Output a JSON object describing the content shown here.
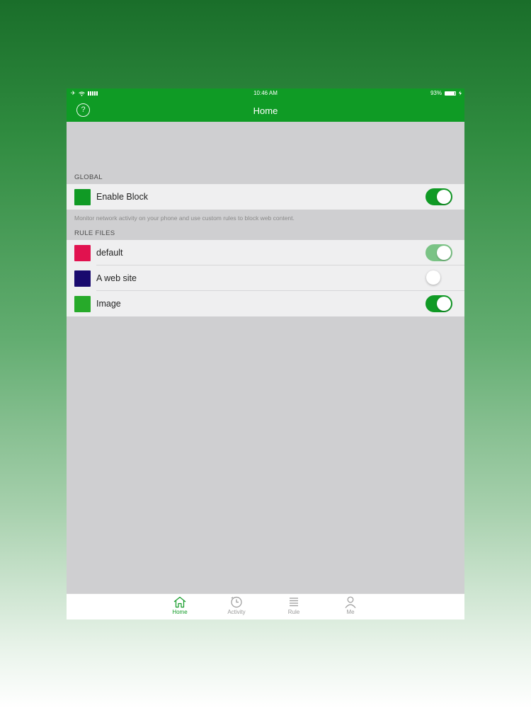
{
  "status_bar": {
    "carrier_signal": "airplane-icon wifi-icon",
    "time": "10:46 AM",
    "battery_percent": "93%",
    "battery_level": 0.93
  },
  "nav": {
    "title": "Home",
    "help_symbol": "?"
  },
  "global_section": {
    "header": "GLOBAL",
    "items": [
      {
        "label": "Enable Block",
        "color": "#109a25",
        "toggle": "on"
      }
    ],
    "footer": "Monitor network activity on your phone and use custom rules to block web content."
  },
  "rules_section": {
    "header": "RULE FILES",
    "items": [
      {
        "label": "default",
        "color": "#e1124f",
        "toggle": "on-light"
      },
      {
        "label": "A web site",
        "color": "#190a6e",
        "toggle": "off"
      },
      {
        "label": "Image",
        "color": "#27aa2a",
        "toggle": "on"
      }
    ]
  },
  "tabs": [
    {
      "label": "Home",
      "icon": "home-icon",
      "active": true
    },
    {
      "label": "Activity",
      "icon": "clock-icon",
      "active": false
    },
    {
      "label": "Rule",
      "icon": "list-icon",
      "active": false
    },
    {
      "label": "Me",
      "icon": "person-icon",
      "active": false
    }
  ],
  "colors": {
    "brand": "#0f9b25",
    "background": "#cfcfd1"
  }
}
